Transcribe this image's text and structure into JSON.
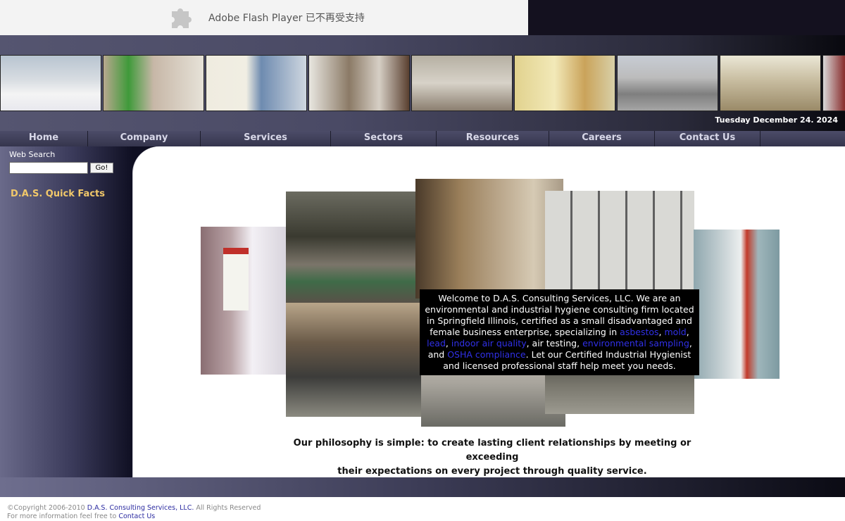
{
  "flash_notice": {
    "text": "Adobe Flash Player 已不再受支持"
  },
  "header": {
    "date": "Tuesday December 24. 2024"
  },
  "nav": {
    "items": [
      {
        "label": "Home"
      },
      {
        "label": "Company"
      },
      {
        "label": "Services"
      },
      {
        "label": "Sectors"
      },
      {
        "label": "Resources"
      },
      {
        "label": "Careers"
      },
      {
        "label": "Contact Us"
      }
    ]
  },
  "sidebar": {
    "search_label": "Web Search",
    "search_value": "",
    "go_label": "Go!",
    "quick_facts": "D.A.S. Quick Facts"
  },
  "welcome": {
    "intro": "Welcome to D.A.S. Consulting Services, LLC. We are an environmental and industrial hygiene consulting firm located in Springfield Illinois, certified as a small disadvantaged and female business enterprise, specializing in ",
    "link_asbestos": "asbestos",
    "sep1": ", ",
    "link_mold": "mold",
    "sep2": ", ",
    "link_lead": "lead",
    "sep3": ", ",
    "link_iaq": "indoor air quality",
    "mid": ", air testing, ",
    "link_env": "environmental sampling",
    "sep4": ", and ",
    "link_osha": "OSHA compliance",
    "outro": ". Let our Certified Industrial Hygienist and licensed professional staff help meet you needs."
  },
  "philosophy": {
    "line1": "Our philosophy is simple: to create lasting client relationships by meeting or exceeding",
    "line2": "their expectations on every project through quality service."
  },
  "footer": {
    "copyright": "©Copyright 2006-2010 ",
    "company_link": "D.A.S. Consulting Services, LLC.",
    "rights": " All Rights Reserved",
    "more_info": "For more information feel free to ",
    "contact_link": "Contact Us"
  },
  "colors": {
    "quick_facts": "#f1c86a",
    "link": "#3030e8",
    "welcome_bg": "#000000"
  }
}
